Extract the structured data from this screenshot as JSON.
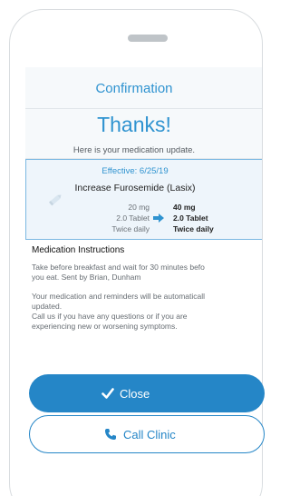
{
  "header": {
    "title": "Confirmation",
    "thanks": "Thanks!",
    "subtitle": "Here is your medication update."
  },
  "update": {
    "effective": "Effective: 6/25/19",
    "drug": "Increase Furosemide (Lasix)",
    "old": {
      "dose": "20 mg",
      "form": "2.0 Tablet",
      "frequency": "Twice daily"
    },
    "new": {
      "dose": "40 mg",
      "form": "2.0 Tablet",
      "frequency": "Twice daily"
    }
  },
  "instructions": {
    "heading": "Medication Instructions",
    "line1": "Take before breakfast and wait for 30 minutes befo",
    "line2": "you eat. Sent by Brian, Dunham",
    "line3": "Your medication and reminders will be automaticall",
    "line4": "updated.",
    "line5": "Call us if you have any questions or if you are",
    "line6": "experiencing new or worsening symptoms."
  },
  "actions": {
    "close_label": "Close",
    "call_label": "Call Clinic"
  },
  "colors": {
    "accent": "#2f93d0",
    "button": "#2586c7"
  },
  "icons": {
    "pencil": "pencil-icon",
    "arrow": "arrow-right-icon",
    "check": "checkmark-icon",
    "phone": "phone-icon"
  }
}
